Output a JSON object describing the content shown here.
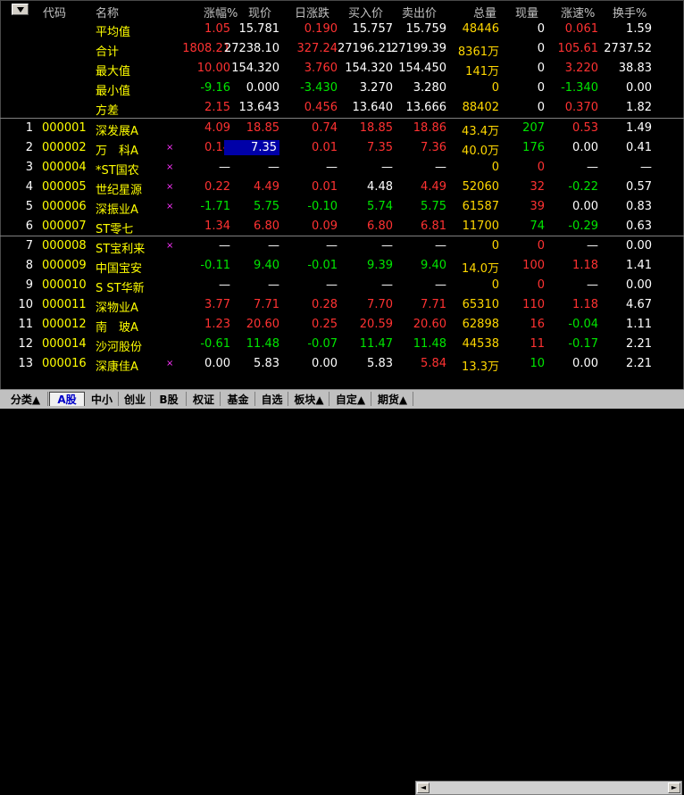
{
  "colors": {
    "up": "#ff3232",
    "down": "#00e600",
    "flat": "#ffffff",
    "yellow": "#ffd700",
    "code": "#ffff00",
    "name": "#ffff00",
    "header": "#c0c0c0",
    "label": "#ffff00"
  },
  "headers": [
    "代码",
    "名称",
    "涨幅%",
    "现价",
    "日涨跌",
    "买入价",
    "卖出价",
    "总量",
    "现量",
    "涨速%",
    "换手%"
  ],
  "stats": [
    {
      "label": "平均值",
      "v": [
        [
          "1.05",
          "up"
        ],
        [
          "15.781",
          "flat"
        ],
        [
          "0.190",
          "up"
        ],
        [
          "15.757",
          "flat"
        ],
        [
          "15.759",
          "flat"
        ],
        [
          "48446",
          "yellow"
        ],
        [
          "0",
          "flat"
        ],
        [
          "0.061",
          "up"
        ],
        [
          "1.59",
          "flat"
        ]
      ]
    },
    {
      "label": "合计",
      "v": [
        [
          "1808.21",
          "up"
        ],
        [
          "27238.10",
          "flat"
        ],
        [
          "327.24",
          "up"
        ],
        [
          "27196.21",
          "flat"
        ],
        [
          "27199.39",
          "flat"
        ],
        [
          "8361万",
          "yellow"
        ],
        [
          "0",
          "flat"
        ],
        [
          "105.61",
          "up"
        ],
        [
          "2737.52",
          "flat"
        ]
      ]
    },
    {
      "label": "最大值",
      "v": [
        [
          "10.00",
          "up"
        ],
        [
          "154.320",
          "flat"
        ],
        [
          "3.760",
          "up"
        ],
        [
          "154.320",
          "flat"
        ],
        [
          "154.450",
          "flat"
        ],
        [
          "141万",
          "yellow"
        ],
        [
          "0",
          "flat"
        ],
        [
          "3.220",
          "up"
        ],
        [
          "38.83",
          "flat"
        ]
      ]
    },
    {
      "label": "最小值",
      "v": [
        [
          "-9.16",
          "down"
        ],
        [
          "0.000",
          "flat"
        ],
        [
          "-3.430",
          "down"
        ],
        [
          "3.270",
          "flat"
        ],
        [
          "3.280",
          "flat"
        ],
        [
          "0",
          "yellow"
        ],
        [
          "0",
          "flat"
        ],
        [
          "-1.340",
          "down"
        ],
        [
          "0.00",
          "flat"
        ]
      ]
    },
    {
      "label": "方差",
      "v": [
        [
          "2.15",
          "up"
        ],
        [
          "13.643",
          "flat"
        ],
        [
          "0.456",
          "up"
        ],
        [
          "13.640",
          "flat"
        ],
        [
          "13.666",
          "flat"
        ],
        [
          "88402",
          "yellow"
        ],
        [
          "0",
          "flat"
        ],
        [
          "0.370",
          "up"
        ],
        [
          "1.82",
          "flat"
        ]
      ]
    }
  ],
  "stocks": [
    {
      "no": "1",
      "code": "000001",
      "name": "深发展A",
      "mark": "",
      "pct": [
        "4.09",
        "up"
      ],
      "price": [
        "18.85",
        "up"
      ],
      "chg": [
        "0.74",
        "up"
      ],
      "bid": [
        "18.85",
        "up"
      ],
      "ask": [
        "18.86",
        "up"
      ],
      "vol": "43.4万",
      "cur": [
        "207",
        "down"
      ],
      "speed": [
        "0.53",
        "up"
      ],
      "turn": "1.49"
    },
    {
      "no": "2",
      "code": "000002",
      "name": "万　科A",
      "mark": "×",
      "pct": [
        "0.14",
        "up"
      ],
      "price": [
        "7.35",
        "flat"
      ],
      "chg": [
        "0.01",
        "up"
      ],
      "bid": [
        "7.35",
        "up"
      ],
      "ask": [
        "7.36",
        "up"
      ],
      "vol": "40.0万",
      "cur": [
        "176",
        "down"
      ],
      "speed": [
        "0.00",
        "flat"
      ],
      "turn": "0.41",
      "selected": true
    },
    {
      "no": "3",
      "code": "000004",
      "name": "*ST国农",
      "mark": "×",
      "pct": [
        "—",
        "flat"
      ],
      "price": [
        "—",
        "flat"
      ],
      "chg": [
        "—",
        "flat"
      ],
      "bid": [
        "—",
        "flat"
      ],
      "ask": [
        "—",
        "flat"
      ],
      "vol": "0",
      "cur": [
        "0",
        "up"
      ],
      "speed": [
        "—",
        "flat"
      ],
      "turn": "—"
    },
    {
      "no": "4",
      "code": "000005",
      "name": "世纪星源",
      "mark": "×",
      "pct": [
        "0.22",
        "up"
      ],
      "price": [
        "4.49",
        "up"
      ],
      "chg": [
        "0.01",
        "up"
      ],
      "bid": [
        "4.48",
        "flat"
      ],
      "ask": [
        "4.49",
        "up"
      ],
      "vol": "52060",
      "cur": [
        "32",
        "up"
      ],
      "speed": [
        "-0.22",
        "down"
      ],
      "turn": "0.57"
    },
    {
      "no": "5",
      "code": "000006",
      "name": "深振业A",
      "mark": "×",
      "pct": [
        "-1.71",
        "down"
      ],
      "price": [
        "5.75",
        "down"
      ],
      "chg": [
        "-0.10",
        "down"
      ],
      "bid": [
        "5.74",
        "down"
      ],
      "ask": [
        "5.75",
        "down"
      ],
      "vol": "61587",
      "cur": [
        "39",
        "up"
      ],
      "speed": [
        "0.00",
        "flat"
      ],
      "turn": "0.83"
    },
    {
      "no": "6",
      "code": "000007",
      "name": "ST零七",
      "mark": "",
      "pct": [
        "1.34",
        "up"
      ],
      "price": [
        "6.80",
        "up"
      ],
      "chg": [
        "0.09",
        "up"
      ],
      "bid": [
        "6.80",
        "up"
      ],
      "ask": [
        "6.81",
        "up"
      ],
      "vol": "11700",
      "cur": [
        "74",
        "down"
      ],
      "speed": [
        "-0.29",
        "down"
      ],
      "turn": "0.63"
    },
    {
      "no": "7",
      "code": "000008",
      "name": "ST宝利来",
      "mark": "×",
      "pct": [
        "—",
        "flat"
      ],
      "price": [
        "—",
        "flat"
      ],
      "chg": [
        "—",
        "flat"
      ],
      "bid": [
        "—",
        "flat"
      ],
      "ask": [
        "—",
        "flat"
      ],
      "vol": "0",
      "cur": [
        "0",
        "up"
      ],
      "speed": [
        "—",
        "flat"
      ],
      "turn": "0.00"
    },
    {
      "no": "8",
      "code": "000009",
      "name": "中国宝安",
      "mark": "",
      "pct": [
        "-0.11",
        "down"
      ],
      "price": [
        "9.40",
        "down"
      ],
      "chg": [
        "-0.01",
        "down"
      ],
      "bid": [
        "9.39",
        "down"
      ],
      "ask": [
        "9.40",
        "down"
      ],
      "vol": "14.0万",
      "cur": [
        "100",
        "up"
      ],
      "speed": [
        "1.18",
        "up"
      ],
      "turn": "1.41"
    },
    {
      "no": "9",
      "code": "000010",
      "name": "S ST华新",
      "mark": "",
      "pct": [
        "—",
        "flat"
      ],
      "price": [
        "—",
        "flat"
      ],
      "chg": [
        "—",
        "flat"
      ],
      "bid": [
        "—",
        "flat"
      ],
      "ask": [
        "—",
        "flat"
      ],
      "vol": "0",
      "cur": [
        "0",
        "up"
      ],
      "speed": [
        "—",
        "flat"
      ],
      "turn": "0.00"
    },
    {
      "no": "10",
      "code": "000011",
      "name": "深物业A",
      "mark": "",
      "pct": [
        "3.77",
        "up"
      ],
      "price": [
        "7.71",
        "up"
      ],
      "chg": [
        "0.28",
        "up"
      ],
      "bid": [
        "7.70",
        "up"
      ],
      "ask": [
        "7.71",
        "up"
      ],
      "vol": "65310",
      "cur": [
        "110",
        "up"
      ],
      "speed": [
        "1.18",
        "up"
      ],
      "turn": "4.67"
    },
    {
      "no": "11",
      "code": "000012",
      "name": "南　玻A",
      "mark": "",
      "pct": [
        "1.23",
        "up"
      ],
      "price": [
        "20.60",
        "up"
      ],
      "chg": [
        "0.25",
        "up"
      ],
      "bid": [
        "20.59",
        "up"
      ],
      "ask": [
        "20.60",
        "up"
      ],
      "vol": "62898",
      "cur": [
        "16",
        "up"
      ],
      "speed": [
        "-0.04",
        "down"
      ],
      "turn": "1.11"
    },
    {
      "no": "12",
      "code": "000014",
      "name": "沙河股份",
      "mark": "",
      "pct": [
        "-0.61",
        "down"
      ],
      "price": [
        "11.48",
        "down"
      ],
      "chg": [
        "-0.07",
        "down"
      ],
      "bid": [
        "11.47",
        "down"
      ],
      "ask": [
        "11.48",
        "down"
      ],
      "vol": "44538",
      "cur": [
        "11",
        "up"
      ],
      "speed": [
        "-0.17",
        "down"
      ],
      "turn": "2.21"
    },
    {
      "no": "13",
      "code": "000016",
      "name": "深康佳A",
      "mark": "×",
      "pct": [
        "0.00",
        "flat"
      ],
      "price": [
        "5.83",
        "flat"
      ],
      "chg": [
        "0.00",
        "flat"
      ],
      "bid": [
        "5.83",
        "flat"
      ],
      "ask": [
        "5.84",
        "up"
      ],
      "vol": "13.3万",
      "cur": [
        "10",
        "down"
      ],
      "speed": [
        "0.00",
        "flat"
      ],
      "turn": "2.21"
    }
  ],
  "tabs": [
    {
      "label": "分类▲",
      "active": false
    },
    {
      "label": "A股",
      "active": true
    },
    {
      "label": "中小",
      "active": false
    },
    {
      "label": "创业",
      "active": false
    },
    {
      "label": "B股",
      "active": false
    },
    {
      "label": "权证",
      "active": false
    },
    {
      "label": "基金",
      "active": false
    },
    {
      "label": "自选",
      "active": false
    },
    {
      "label": "板块▲",
      "active": false
    },
    {
      "label": "自定▲",
      "active": false
    },
    {
      "label": "期货▲",
      "active": false
    }
  ],
  "scrollbar": {
    "left": "◄",
    "right": "►"
  }
}
